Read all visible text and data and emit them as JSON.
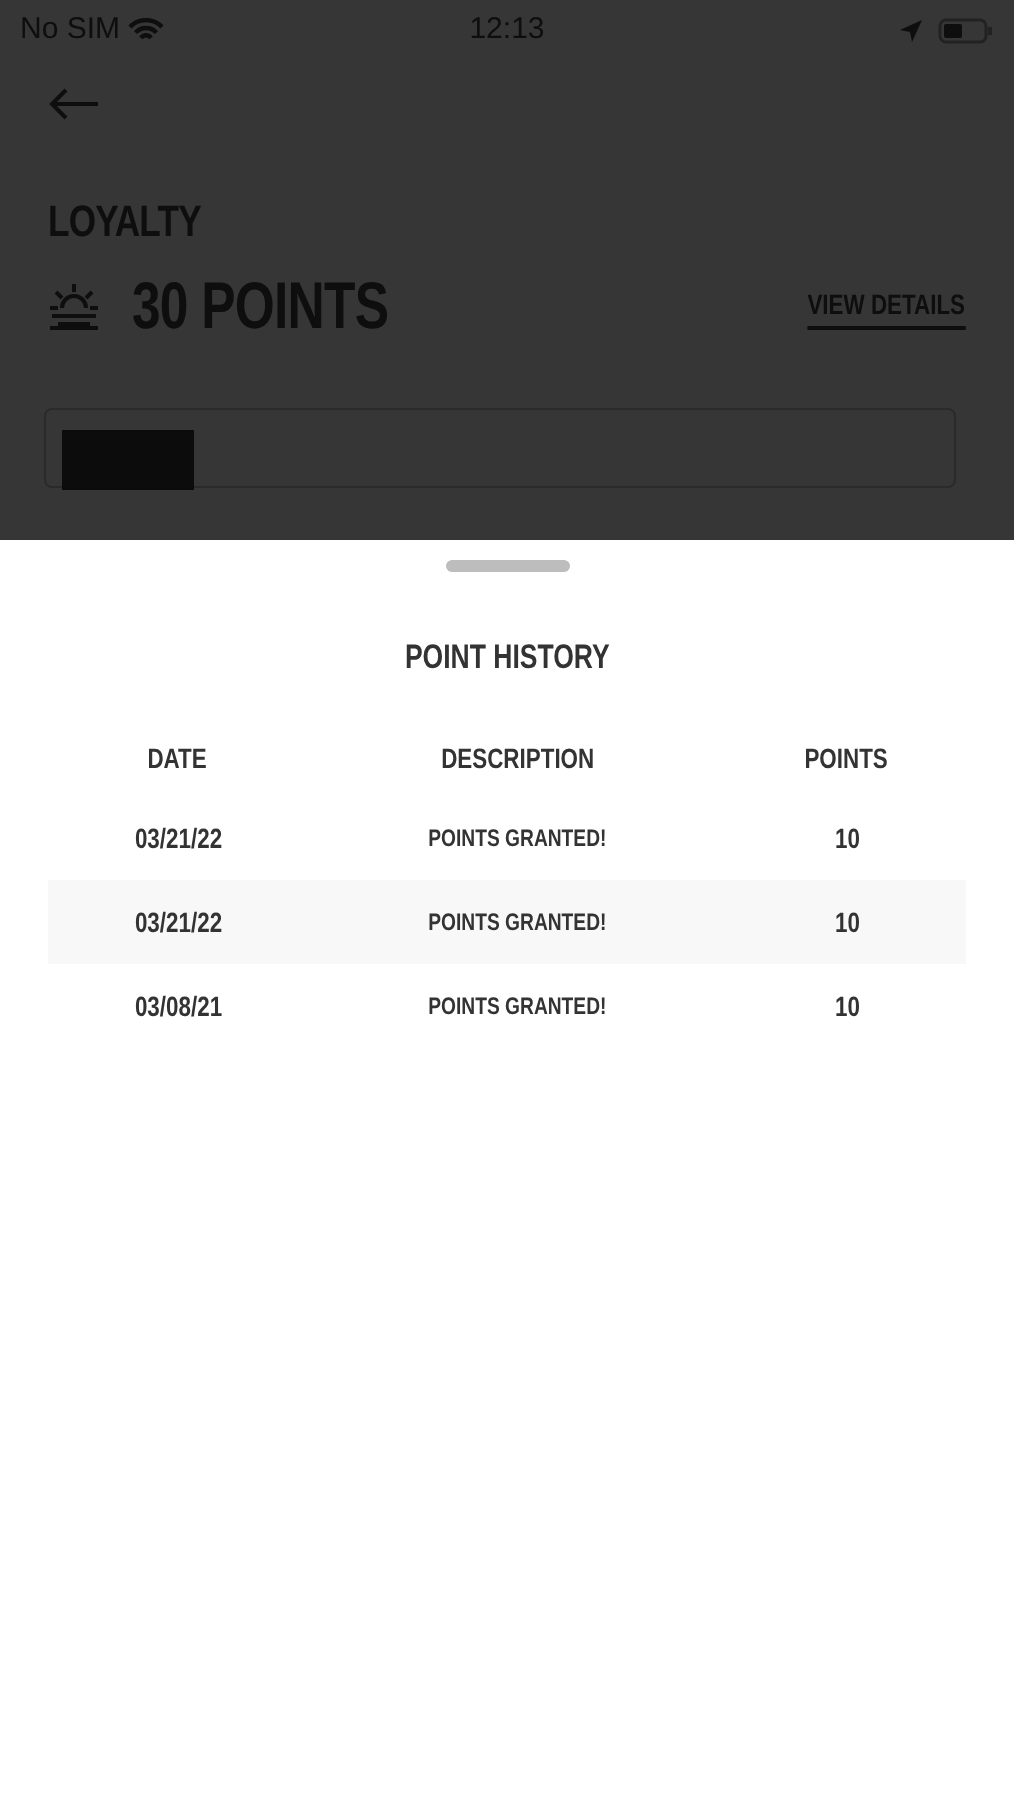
{
  "status_bar": {
    "carrier": "No SIM",
    "time": "12:13"
  },
  "page": {
    "title": "LOYALTY",
    "points": "30 POINTS",
    "view_details": "VIEW DETAILS"
  },
  "sheet": {
    "title": "POINT HISTORY",
    "columns": [
      "DATE",
      "DESCRIPTION",
      "POINTS"
    ],
    "rows": [
      {
        "date": "03/21/22",
        "description": "POINTS GRANTED!",
        "points": "10"
      },
      {
        "date": "03/21/22",
        "description": "POINTS GRANTED!",
        "points": "10"
      },
      {
        "date": "03/08/21",
        "description": "POINTS GRANTED!",
        "points": "10"
      }
    ]
  }
}
